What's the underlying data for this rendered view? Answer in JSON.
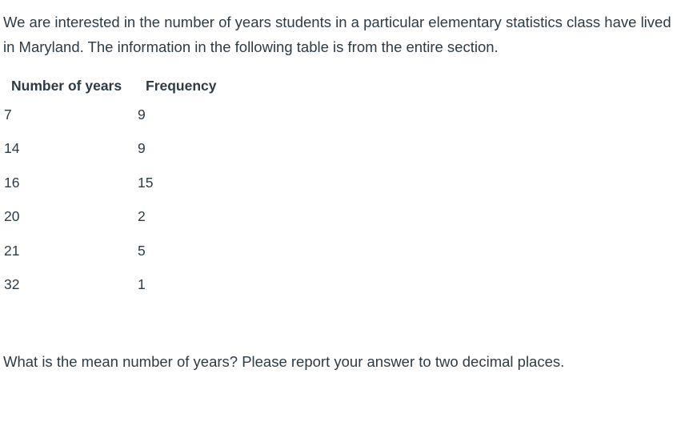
{
  "intro_text": "We are interested in the number of years students in a particular elementary statistics class have lived in Maryland. The information in the following table is from the entire section.",
  "table": {
    "headers": [
      "Number of years",
      "Frequency"
    ],
    "rows": [
      [
        "7",
        "9"
      ],
      [
        "14",
        "9"
      ],
      [
        "16",
        "15"
      ],
      [
        "20",
        "2"
      ],
      [
        "21",
        "5"
      ],
      [
        "32",
        "1"
      ]
    ]
  },
  "question_text": "What is the mean number of years? Please report your answer to two decimal places."
}
